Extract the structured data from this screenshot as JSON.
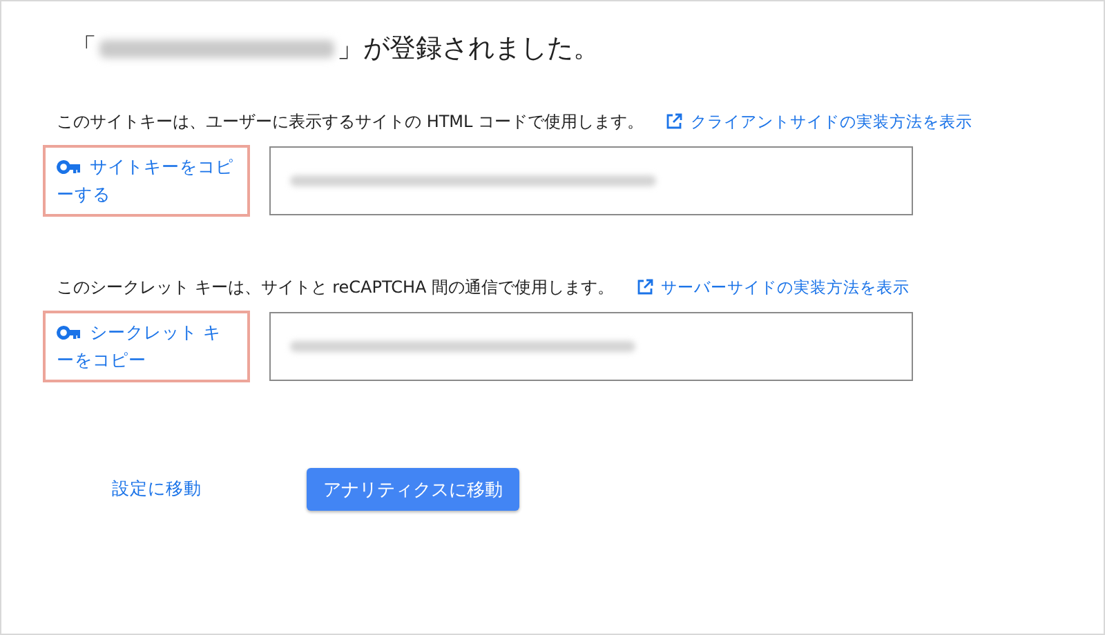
{
  "title": {
    "prefix": "「",
    "suffix": "」が登録されました。"
  },
  "sections": [
    {
      "description": "このサイトキーは、ユーザーに表示するサイトの HTML コードで使用します。",
      "link": "クライアントサイドの実装方法を表示",
      "copy_button": {
        "label": "サイトキーをコピーする",
        "highlighted": true
      }
    },
    {
      "description": "このシークレット キーは、サイトと reCAPTCHA 間の通信で使用します。",
      "link": "サーバーサイドの実装方法を表示",
      "copy_button": {
        "label": "シークレット キーをコピー",
        "highlighted": true
      }
    }
  ],
  "settings_link": "設定に移動",
  "analytics_button": "アナリティクスに移動"
}
